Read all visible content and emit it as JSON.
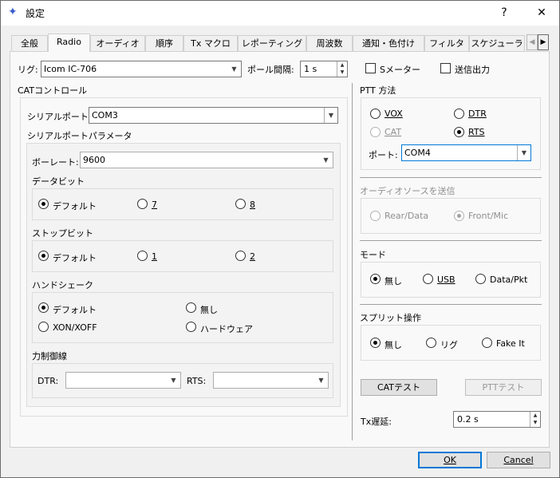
{
  "window": {
    "title": "設定",
    "help_btn": "?",
    "close_btn": "✕"
  },
  "tabs": [
    "全般",
    "Radio",
    "オーディオ",
    "順序",
    "Tx マクロ",
    "レポーティング",
    "周波数",
    "通知・色付け",
    "フィルタ",
    "スケジューラ"
  ],
  "tab_arrows": {
    "left": "◀",
    "right": "▶"
  },
  "rig": {
    "label": "リグ:",
    "value": "Icom IC-706",
    "poll_label": "ポール間隔:",
    "poll_value": "1 s",
    "smeter_label": "Sメーター",
    "tx_power_label": "送信出力"
  },
  "cat": {
    "title": "CATコントロール",
    "serial_port_label": "シリアルポート:",
    "serial_port_value": "COM3",
    "params_title": "シリアルポートパラメータ",
    "baud_label": "ボーレート:",
    "baud_value": "9600",
    "databits_title": "データビット",
    "databits": [
      "デフォルト",
      "7",
      "8"
    ],
    "stopbits_title": "ストップビット",
    "stopbits": [
      "デフォルト",
      "1",
      "2"
    ],
    "handshake_title": "ハンドシェーク",
    "handshake": [
      "デフォルト",
      "無し",
      "XON/XOFF",
      "ハードウェア"
    ],
    "force_title": "力制御線",
    "dtr_label": "DTR:",
    "rts_label": "RTS:"
  },
  "ptt": {
    "title": "PTT 方法",
    "options": [
      "VOX",
      "DTR",
      "CAT",
      "RTS"
    ],
    "port_label": "ポート:",
    "port_value": "COM4"
  },
  "audio_src": {
    "title": "オーディオソースを送信",
    "options": [
      "Rear/Data",
      "Front/Mic"
    ]
  },
  "mode": {
    "title": "モード",
    "options": [
      "無し",
      "USB",
      "Data/Pkt"
    ]
  },
  "split": {
    "title": "スプリット操作",
    "options": [
      "無し",
      "リグ",
      "Fake It"
    ]
  },
  "buttons": {
    "cat_test": "CATテスト",
    "ptt_test": "PTTテスト",
    "ok": "OK",
    "cancel": "Cancel"
  },
  "tx_delay": {
    "label": "Tx遅延:",
    "value": "0.2 s"
  }
}
